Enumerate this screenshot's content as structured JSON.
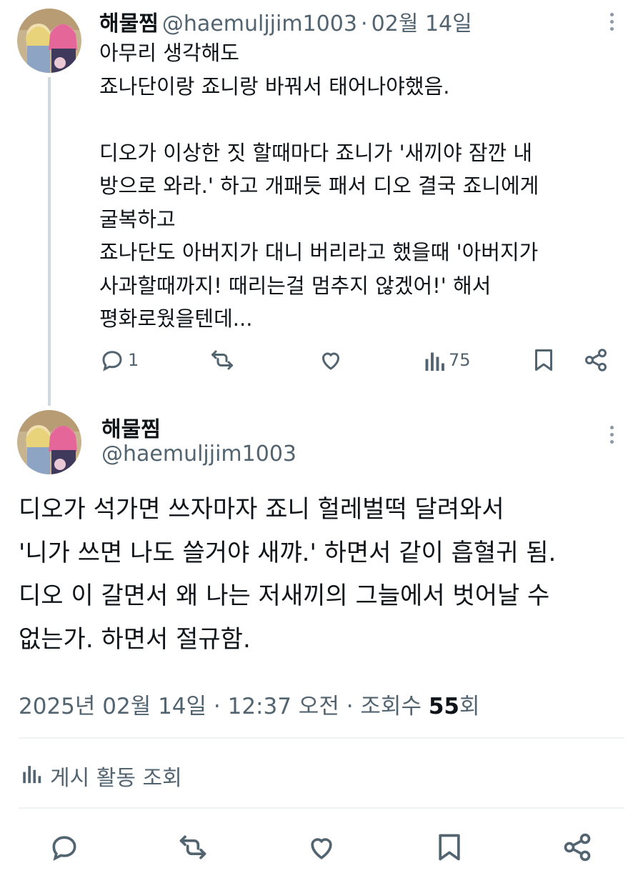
{
  "parent_tweet": {
    "display_name": "해물찜",
    "handle": "@haemuljjim1003",
    "separator": "·",
    "date": "02월 14일",
    "text": "아무리 생각해도\n죠나단이랑 죠니랑 바꿔서 태어나야했음.\n\n디오가 이상한 짓 할때마다 죠니가 '새끼야 잠깐 내\n방으로 와라.' 하고 개패듯 패서 디오 결국 죠니에게\n굴복하고\n죠나단도 아버지가 대니 버리라고 했을때 '아버지가\n사과할때까지! 때리는걸 멈추지 않겠어!' 해서\n평화로웠을텐데...",
    "reply_count": "1",
    "view_count": "75"
  },
  "main_tweet": {
    "display_name": "해물찜",
    "handle": "@haemuljjim1003",
    "text": "디오가 석가면 쓰자마자 죠니 헐레벌떡 달려와서\n'니가 쓰면 나도 쓸거야 새꺄.' 하면서 같이 흡혈귀 됨.\n디오 이 갈면서 왜 나는 저새끼의 그늘에서 벗어날 수\n없는가. 하면서 절규함.",
    "timestamp_prefix": "2025년 02월 14일 · 12:37 오전 · 조회수 ",
    "views": "55",
    "views_suffix": "회",
    "activity_label": "게시 활동 조회"
  },
  "icons": {
    "reply": "reply-icon",
    "retweet": "retweet-icon",
    "like": "like-icon",
    "views": "views-icon",
    "bookmark": "bookmark-icon",
    "share": "share-icon",
    "more": "more-icon",
    "analytics": "analytics-icon"
  },
  "colors": {
    "text": "#0f1419",
    "secondary": "#536471",
    "divider": "#eff3f4",
    "thread_line": "#cfd9de"
  }
}
